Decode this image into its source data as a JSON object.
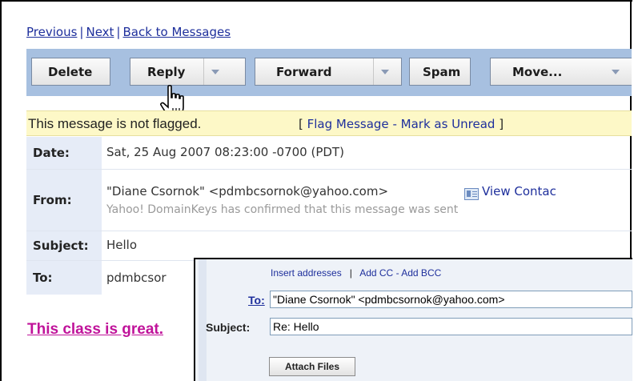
{
  "nav": {
    "previous": "Previous",
    "next": "Next",
    "back": "Back to Messages",
    "sep": "|"
  },
  "toolbar": {
    "delete": "Delete",
    "reply": "Reply",
    "forward": "Forward",
    "spam": "Spam",
    "move": "Move..."
  },
  "flag": {
    "status": "This message is not flagged.",
    "open_bracket": "[",
    "flag_link": "Flag Message",
    "dash": "-",
    "unread_link": "Mark as Unread",
    "close_bracket": "]"
  },
  "headers": {
    "date_label": "Date:",
    "date_value": "Sat, 25 Aug 2007 08:23:00 -0700 (PDT)",
    "from_label": "From:",
    "from_value": "\"Diane Csornok\" <pdmbcsornok@yahoo.com>",
    "view_contact": "View Contac",
    "domainkeys": "Yahoo! DomainKeys has confirmed that this message was sent",
    "subject_label": "Subject:",
    "subject_value": "Hello",
    "to_label": "To:",
    "to_value": "pdmbcsor"
  },
  "body_text": "This class is great.",
  "compose": {
    "insert_addresses": "Insert addresses",
    "sep": "|",
    "add_cc": "Add CC",
    "dash": "-",
    "add_bcc": "Add BCC",
    "to_label": "To:",
    "to_value": "\"Diane Csornok\" <pdmbcsornok@yahoo.com>",
    "subject_label": "Subject:",
    "subject_value": "Re: Hello",
    "attach_files": "Attach Files"
  },
  "colors": {
    "toolbar": "#a7c0e0",
    "flagbar": "#fdf8c7",
    "link": "#1e2f9c",
    "body_text": "#c0139a"
  },
  "icons": [
    "dropdown-arrow-icon",
    "contact-card-icon",
    "hand-cursor-icon"
  ]
}
